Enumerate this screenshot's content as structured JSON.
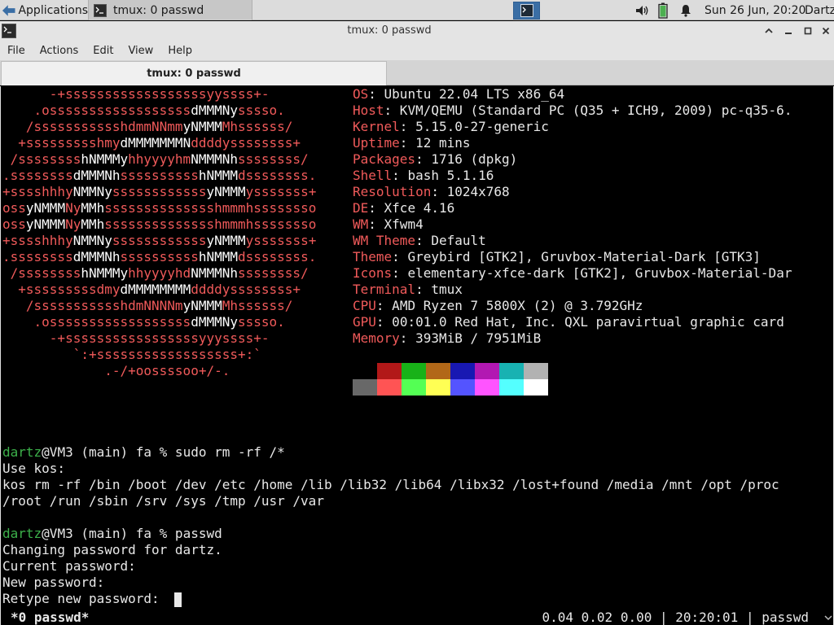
{
  "panel": {
    "applications_label": "Applications",
    "task_label": "tmux: 0 passwd",
    "clock": "Sun 26 Jun, 20:20",
    "user": "Dartz"
  },
  "window": {
    "title": "tmux: 0 passwd",
    "menus": [
      "File",
      "Actions",
      "Edit",
      "View",
      "Help"
    ],
    "tab_label": "tmux: 0 passwd"
  },
  "neofetch": {
    "logo": [
      "      -+ssssssssssssssssssyyssss+-",
      "    .ossssssssssssssssssdMMMNysssso.",
      "   /ssssssssssshdmmNNmmyNMMMMhssssss/",
      "  +ssssssssshmydMMMMMMMNddddyssssssss+",
      " /sssssssshNMMMyhhyyyyhmNMMMNhssssssss/",
      ".ssssssssdMMMNhsssssssssshNMMMdssssssss.",
      "+sssshhhyNMMNyssssssssssssyNMMMysssssss+",
      "ossyNMMMNyMMhsssssssssssssshmmmhssssssso",
      "ossyNMMMNyMMhsssssssssssssshmmmhssssssso",
      "+sssshhhyNMMNyssssssssssssyNMMMysssssss+",
      ".ssssssssdMMMNhsssssssssshNMMMdssssssss.",
      " /sssssssshNMMMyhhyyyyhdNMMMNhssssssss/",
      "  +sssssssssdmydMMMMMMMMddddyssssssss+",
      "   /ssssssssssshdmNNNNmyNMMMMhssssss/",
      "    .ossssssssssssssssssdMMMNysssso.",
      "      -+sssssssssssssssssyyyssss+-",
      "         `:+ssssssssssssssssss+:`",
      "             .-/+oossssoo+/-."
    ],
    "info": [
      {
        "key": "OS",
        "value": " Ubuntu 22.04 LTS x86_64"
      },
      {
        "key": "Host",
        "value": " KVM/QEMU (Standard PC (Q35 + ICH9, 2009) pc-q35-6."
      },
      {
        "key": "Kernel",
        "value": " 5.15.0-27-generic"
      },
      {
        "key": "Uptime",
        "value": " 12 mins"
      },
      {
        "key": "Packages",
        "value": " 1716 (dpkg)"
      },
      {
        "key": "Shell",
        "value": " bash 5.1.16"
      },
      {
        "key": "Resolution",
        "value": " 1024x768"
      },
      {
        "key": "DE",
        "value": " Xfce 4.16"
      },
      {
        "key": "WM",
        "value": " Xfwm4"
      },
      {
        "key": "WM Theme",
        "value": " Default"
      },
      {
        "key": "Theme",
        "value": " Greybird [GTK2], Gruvbox-Material-Dark [GTK3]"
      },
      {
        "key": "Icons",
        "value": " elementary-xfce-dark [GTK2], Gruvbox-Material-Dar"
      },
      {
        "key": "Terminal",
        "value": " tmux"
      },
      {
        "key": "CPU",
        "value": " AMD Ryzen 7 5800X (2) @ 3.792GHz"
      },
      {
        "key": "GPU",
        "value": " 00:01.0 Red Hat, Inc. QXL paravirtual graphic card"
      },
      {
        "key": "Memory",
        "value": " 393MiB / 7951MiB"
      }
    ],
    "palette_top": [
      "#000000",
      "#b21818",
      "#18b218",
      "#b26818",
      "#1818b2",
      "#b218b2",
      "#18b2b2",
      "#b2b2b2"
    ],
    "palette_bottom": [
      "#686868",
      "#ff5454",
      "#54ff54",
      "#ffff54",
      "#5454ff",
      "#ff54ff",
      "#54ffff",
      "#ffffff"
    ]
  },
  "terminal": {
    "prompt1_user": "dartz",
    "prompt1_rest": "@VM3 (main) fa % sudo rm -rf /*",
    "out1": "Use kos:",
    "out2": "kos rm -rf /bin /boot /dev /etc /home /lib /lib32 /lib64 /libx32 /lost+found /media /mnt /opt /proc",
    "out3": "/root /run /sbin /srv /sys /tmp /usr /var",
    "prompt2_user": "dartz",
    "prompt2_rest": "@VM3 (main) fa % passwd",
    "out4": "Changing password for dartz.",
    "out5": "Current password:",
    "out6": "New password:",
    "out7": "Retype new password: "
  },
  "tmux_status": {
    "window_label": "*0 passwd*",
    "right": "0.04 0.02 0.00 | 20:20:01 | passwd"
  }
}
